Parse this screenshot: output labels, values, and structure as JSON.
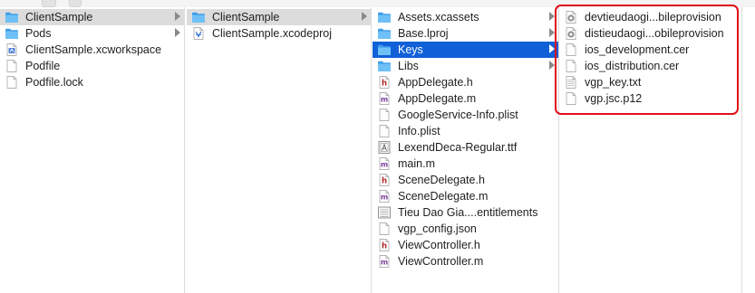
{
  "columns": [
    {
      "items": [
        {
          "label": "ClientSample",
          "icon": "folder-icon",
          "state": "selected",
          "chevron": true
        },
        {
          "label": "Pods",
          "icon": "folder-icon",
          "state": "",
          "chevron": true
        },
        {
          "label": "ClientSample.xcworkspace",
          "icon": "xcworkspace-file-icon",
          "state": "",
          "chevron": false
        },
        {
          "label": "Podfile",
          "icon": "document-icon",
          "state": "",
          "chevron": false
        },
        {
          "label": "Podfile.lock",
          "icon": "document-icon",
          "state": "",
          "chevron": false
        }
      ]
    },
    {
      "items": [
        {
          "label": "ClientSample",
          "icon": "folder-icon",
          "state": "selected",
          "chevron": true
        },
        {
          "label": "ClientSample.xcodeproj",
          "icon": "xcodeproj-file-icon",
          "state": "",
          "chevron": false
        }
      ]
    },
    {
      "items": [
        {
          "label": "Assets.xcassets",
          "icon": "folder-icon",
          "state": "",
          "chevron": true
        },
        {
          "label": "Base.lproj",
          "icon": "folder-icon",
          "state": "",
          "chevron": true
        },
        {
          "label": "Keys",
          "icon": "folder-icon",
          "state": "active",
          "chevron": true
        },
        {
          "label": "Libs",
          "icon": "folder-icon",
          "state": "",
          "chevron": true
        },
        {
          "label": "AppDelegate.h",
          "icon": "header-file-icon",
          "state": "",
          "chevron": false
        },
        {
          "label": "AppDelegate.m",
          "icon": "objc-file-icon",
          "state": "",
          "chevron": false
        },
        {
          "label": "GoogleService-Info.plist",
          "icon": "document-icon",
          "state": "",
          "chevron": false
        },
        {
          "label": "Info.plist",
          "icon": "document-icon",
          "state": "",
          "chevron": false
        },
        {
          "label": "LexendDeca-Regular.ttf",
          "icon": "font-file-icon",
          "state": "",
          "chevron": false
        },
        {
          "label": "main.m",
          "icon": "objc-file-icon",
          "state": "",
          "chevron": false
        },
        {
          "label": "SceneDelegate.h",
          "icon": "header-file-icon",
          "state": "",
          "chevron": false
        },
        {
          "label": "SceneDelegate.m",
          "icon": "objc-file-icon",
          "state": "",
          "chevron": false
        },
        {
          "label": "Tieu Dao Gia....entitlements",
          "icon": "entitlements-file-icon",
          "state": "",
          "chevron": false
        },
        {
          "label": "vgp_config.json",
          "icon": "document-icon",
          "state": "",
          "chevron": false
        },
        {
          "label": "ViewController.h",
          "icon": "header-file-icon",
          "state": "",
          "chevron": false
        },
        {
          "label": "ViewController.m",
          "icon": "objc-file-icon",
          "state": "",
          "chevron": false
        }
      ]
    },
    {
      "items": [
        {
          "label": "devtieudaogi...bileprovision",
          "icon": "provisioning-profile-icon",
          "state": "",
          "chevron": false
        },
        {
          "label": "distieudaogi...obileprovision",
          "icon": "provisioning-profile-icon",
          "state": "",
          "chevron": false
        },
        {
          "label": "ios_development.cer",
          "icon": "document-icon",
          "state": "",
          "chevron": false
        },
        {
          "label": "ios_distribution.cer",
          "icon": "document-icon",
          "state": "",
          "chevron": false
        },
        {
          "label": "vgp_key.txt",
          "icon": "text-file-icon",
          "state": "",
          "chevron": false
        },
        {
          "label": "vgp.jsc.p12",
          "icon": "document-icon",
          "state": "",
          "chevron": false
        }
      ]
    }
  ]
}
